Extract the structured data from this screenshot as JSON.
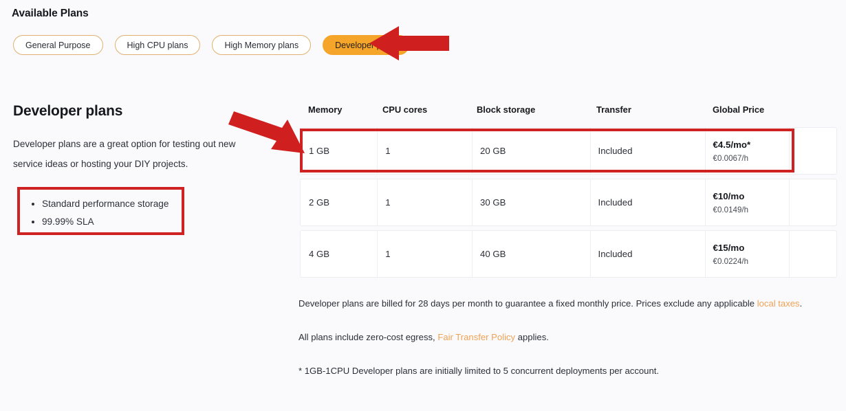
{
  "header": {
    "title": "Available Plans",
    "tabs": [
      {
        "label": "General Purpose",
        "active": false
      },
      {
        "label": "High CPU plans",
        "active": false
      },
      {
        "label": "High Memory plans",
        "active": false
      },
      {
        "label": "Developer plans",
        "active": true
      }
    ]
  },
  "details": {
    "title": "Developer plans",
    "description": "Developer plans are a great option for testing out new service ideas or hosting your DIY projects.",
    "features": [
      "Standard performance storage",
      "99.99% SLA"
    ]
  },
  "table": {
    "columns": [
      "Memory",
      "CPU cores",
      "Block storage",
      "Transfer",
      "Global Price"
    ],
    "rows": [
      {
        "memory": "1 GB",
        "cpu": "1",
        "storage": "20 GB",
        "transfer": "Included",
        "price_month": "€4.5/mo*",
        "price_hour": "€0.0067/h",
        "highlighted": true
      },
      {
        "memory": "2 GB",
        "cpu": "1",
        "storage": "30 GB",
        "transfer": "Included",
        "price_month": "€10/mo",
        "price_hour": "€0.0149/h",
        "highlighted": false
      },
      {
        "memory": "4 GB",
        "cpu": "1",
        "storage": "40 GB",
        "transfer": "Included",
        "price_month": "€15/mo",
        "price_hour": "€0.0224/h",
        "highlighted": false
      }
    ]
  },
  "notes": {
    "billing_part1": "Developer plans are billed for 28 days per month to guarantee a fixed monthly price. Prices exclude any applicable ",
    "billing_link": "local taxes",
    "billing_part2": ".",
    "egress_part1": "All plans include zero-cost egress, ",
    "egress_link": "Fair Transfer Policy",
    "egress_part2": " applies.",
    "footnote": "* 1GB-1CPU Developer plans are initially limited to 5 concurrent deployments per account."
  },
  "annotations": {
    "arrow_color": "#cf2222",
    "highlight_color": "#cf2222",
    "accent_color": "#f4a52a",
    "link_color": "#f0a254"
  }
}
